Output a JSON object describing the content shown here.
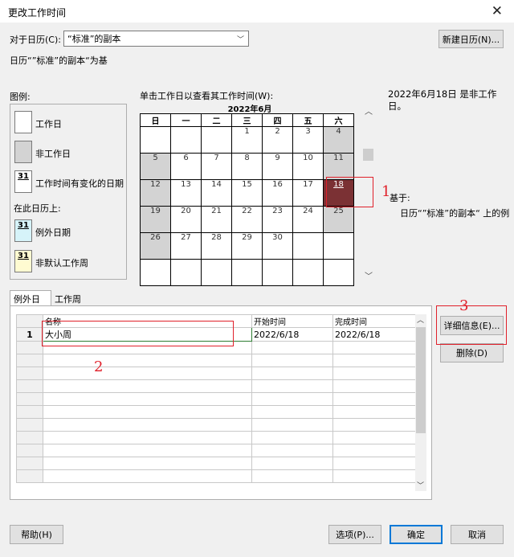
{
  "dialog": {
    "title": "更改工作时间"
  },
  "header": {
    "for_calendar_label": "对于日历(C):",
    "calendar_value": "“标准”的副本",
    "new_calendar_button": "新建日历(N)...",
    "based_on_text": "日历“”标准”的副本“为基"
  },
  "legend": {
    "title": "图例:",
    "working": "工作日",
    "nonworking": "非工作日",
    "changed": "工作时间有变化的日期",
    "on_this_calendar": "在此日历上:",
    "exception": "例外日期",
    "nondefault": "非默认工作周",
    "swatch_num": "31"
  },
  "calendar": {
    "instruction": "单击工作日以查看其工作时间(W):",
    "month_label": "2022年6月",
    "weekdays": [
      "日",
      "一",
      "二",
      "三",
      "四",
      "五",
      "六"
    ],
    "weeks": [
      [
        "",
        "",
        "",
        "1",
        "2",
        "3",
        "4"
      ],
      [
        "5",
        "6",
        "7",
        "8",
        "9",
        "10",
        "11"
      ],
      [
        "12",
        "13",
        "14",
        "15",
        "16",
        "17",
        "18"
      ],
      [
        "19",
        "20",
        "21",
        "22",
        "23",
        "24",
        "25"
      ],
      [
        "26",
        "27",
        "28",
        "29",
        "30",
        "",
        ""
      ],
      [
        "",
        "",
        "",
        "",
        "",
        "",
        ""
      ]
    ],
    "selected_day": "18"
  },
  "info": {
    "status": "2022年6月18日 是非工作日。",
    "based_on_label": "基于:",
    "based_on_detail": "日历“”标准”的副本“ 上的例"
  },
  "tabs": [
    {
      "label": "例外日期"
    },
    {
      "label": "工作周"
    }
  ],
  "exceptions": {
    "columns": [
      "名称",
      "开始时间",
      "完成时间"
    ],
    "rows": [
      {
        "num": "1",
        "name": "大小周",
        "start": "2022/6/18",
        "finish": "2022/6/18"
      }
    ]
  },
  "buttons": {
    "details": "详细信息(E)...",
    "delete": "删除(D)",
    "help": "帮助(H)",
    "options": "选项(P)...",
    "ok": "确定",
    "cancel": "取消"
  },
  "annotations": {
    "a1": "1",
    "a2": "2",
    "a3": "3"
  },
  "colors": {
    "selected_day": "#7b3134",
    "nonworking": "#d3d3d3",
    "annotation": "#e0202a",
    "ok_border": "#0078d7"
  }
}
